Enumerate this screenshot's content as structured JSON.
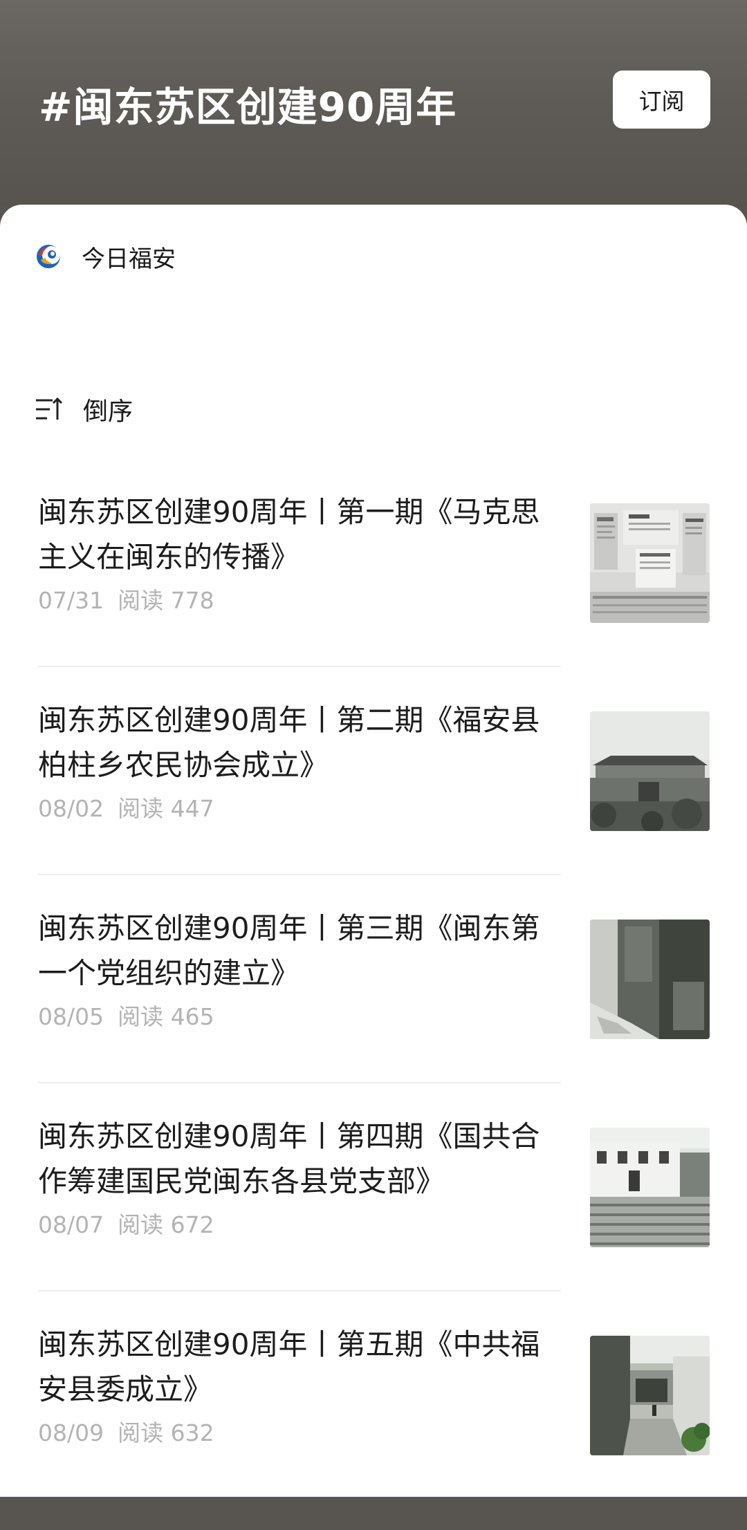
{
  "header": {
    "topic_title": "#闽东苏区创建90周年",
    "subscribe_label": "订阅"
  },
  "source": {
    "name": "今日福安"
  },
  "sort": {
    "label": "倒序"
  },
  "articles": [
    {
      "title": "闽东苏区创建90周年丨第一期《马克思主义在闽东的传播》",
      "date": "07/31",
      "reads": "阅读 778",
      "thumbnail": "exhibition-wall-photo"
    },
    {
      "title": "闽东苏区创建90周年丨第二期《福安县柏柱乡农民协会成立》",
      "date": "08/02",
      "reads": "阅读 447",
      "thumbnail": "old-building-photo"
    },
    {
      "title": "闽东苏区创建90周年丨第三期《闽东第一个党组织的建立》",
      "date": "08/05",
      "reads": "阅读 465",
      "thumbnail": "old-door-photo"
    },
    {
      "title": "闽东苏区创建90周年丨第四期《国共合作筹建国民党闽东各县党支部》",
      "date": "08/07",
      "reads": "阅读 672",
      "thumbnail": "building-stairs-photo"
    },
    {
      "title": "闽东苏区创建90周年丨第五期《中共福安县委成立》",
      "date": "08/09",
      "reads": "阅读 632",
      "thumbnail": "alley-photo"
    }
  ],
  "colors": {
    "header_bg": "#5f5b57",
    "card_bg": "#ffffff",
    "meta_text": "#b3b3b3",
    "divider": "#eeeeee"
  }
}
